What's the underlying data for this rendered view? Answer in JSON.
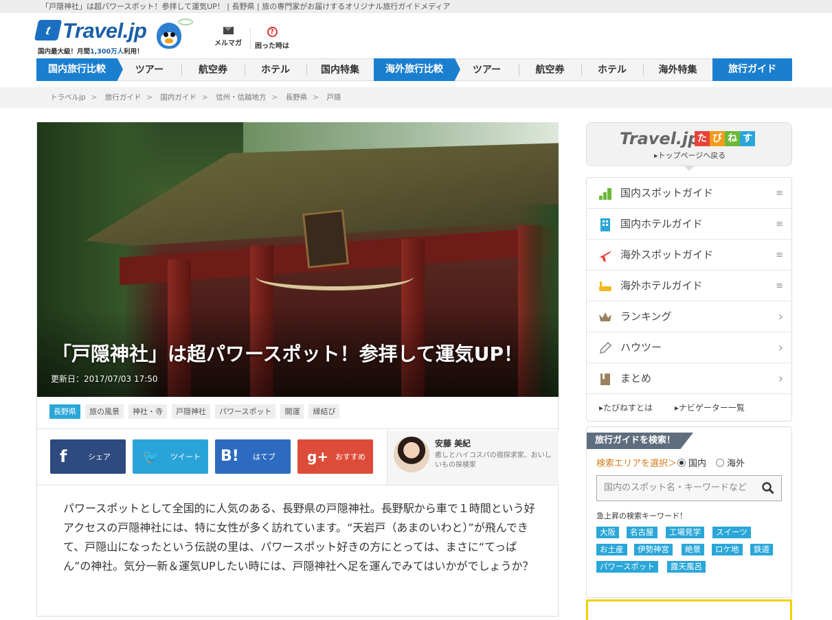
{
  "topbar": {
    "text": "「戸隠神社」は超パワースポット！参拝して運気UP！ | 長野県 | 旅の専門家がお届けするオリジナル旅行ガイドメディア"
  },
  "header": {
    "logo_mark": "t",
    "logo_text": "Travel.jp",
    "logo_sub_1": "国内最大級！月間",
    "logo_sub_num": "1,300万人",
    "logo_sub_2": "利用！",
    "mail_label": "メルマガ",
    "help_label": "困った時は",
    "help_glyph": "?"
  },
  "nav": [
    {
      "label": "国内旅行比較",
      "type": "blue-arrow"
    },
    {
      "label": "ツアー",
      "type": "plain"
    },
    {
      "label": "航空券",
      "type": "plain"
    },
    {
      "label": "ホテル",
      "type": "plain"
    },
    {
      "label": "国内特集",
      "type": "plain"
    },
    {
      "label": "海外旅行比較",
      "type": "blue-arrow"
    },
    {
      "label": "ツアー",
      "type": "plain"
    },
    {
      "label": "航空券",
      "type": "plain"
    },
    {
      "label": "ホテル",
      "type": "plain"
    },
    {
      "label": "海外特集",
      "type": "plain"
    },
    {
      "label": "旅行ガイド",
      "type": "blue"
    }
  ],
  "breadcrumbs": [
    "トラベルjp",
    "旅行ガイド",
    "国内ガイド",
    "信州・信越地方",
    "長野県",
    "戸隠"
  ],
  "article": {
    "title": "「戸隠神社」は超パワースポット！参拝して運気UP！",
    "updated": "更新日：2017/07/03 17:50",
    "tags": [
      "長野県",
      "旅の風景",
      "神社・寺",
      "戸隠神社",
      "パワースポット",
      "開運",
      "縁結び"
    ],
    "share": {
      "facebook": {
        "icon": "f",
        "label": "シェア"
      },
      "twitter": {
        "icon": "🐦",
        "label": "ツイート"
      },
      "hatena": {
        "icon": "B!",
        "label": "はてブ"
      },
      "google": {
        "icon": "g+",
        "label": "おすすめ"
      }
    },
    "author": {
      "name": "安藤 美紀",
      "desc": "癒しとハイコスパの宿探求家、おいしいもの探検家"
    },
    "body": "パワースポットとして全国的に人気のある、長野県の戸隠神社。長野駅から車で１時間という好アクセスの戸隠神社には、特に女性が多く訪れています。“天岩戸（あまのいわと）”が飛んできて、戸隠山になったという伝説の里は、パワースポット好きの方にとっては、まさに“てっぱん”の神社。気分一新＆運気UPしたい時には、戸隠神社へ足を運んでみてはいかがでしょうか？"
  },
  "sidebar": {
    "brand": "Travel.jp",
    "badges": [
      {
        "char": "た",
        "color": "#e8433a"
      },
      {
        "char": "び",
        "color": "#f29b1d"
      },
      {
        "char": "ね",
        "color": "#6cb83a"
      },
      {
        "char": "す",
        "color": "#2aa6d8"
      }
    ],
    "back_label": "トップページへ戻る",
    "menu": [
      {
        "label": "国内スポットガイド",
        "end": "≡",
        "icon": "domestic-spot-icon"
      },
      {
        "label": "国内ホテルガイド",
        "end": "≡",
        "icon": "domestic-hotel-icon"
      },
      {
        "label": "海外スポットガイド",
        "end": "≡",
        "icon": "airplane-icon"
      },
      {
        "label": "海外ホテルガイド",
        "end": "≡",
        "icon": "bathtub-icon"
      },
      {
        "label": "ランキング",
        "end": "›",
        "icon": "crown-icon"
      },
      {
        "label": "ハウツー",
        "end": "›",
        "icon": "pencil-icon"
      },
      {
        "label": "まとめ",
        "end": "›",
        "icon": "book-icon"
      }
    ],
    "menu_foot": [
      "たびねすとは",
      "ナビゲーター一覧"
    ],
    "search": {
      "title": "旅行ガイドを検索！",
      "area_label": "検索エリアを選択＞",
      "domestic": "国内",
      "overseas": "海外",
      "placeholder": "国内のスポット名・キーワードなど",
      "keywords_label": "急上昇の検索キーワード！",
      "keywords": [
        "大阪",
        "名古屋",
        "工場見学",
        "スイーツ",
        "お土産",
        "伊勢神宮",
        "絶景",
        "ロケ地",
        "鉄道",
        "パワースポット",
        "露天風呂"
      ]
    }
  },
  "colors": {
    "brand_blue": "#1b7fd0",
    "tag_highlight": "#2aa6d8",
    "facebook": "#2e4a7e",
    "twitter": "#2aa4d8",
    "hatena": "#2d6bc0",
    "google": "#dd4b39"
  }
}
